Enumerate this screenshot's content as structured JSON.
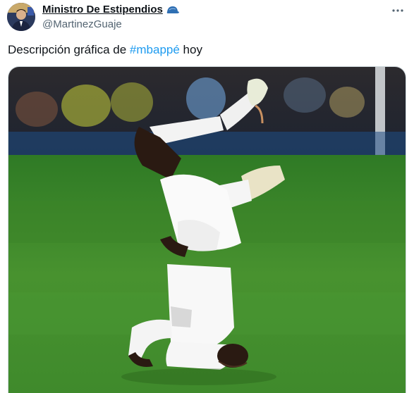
{
  "author": {
    "display_name": "Ministro De Estipendios",
    "handle": "@MartinezGuaje",
    "avatar_icon": "avatar-portrait",
    "badge_icon": "blue-cap-icon"
  },
  "tweet": {
    "text_before": "Descripción gráfica de ",
    "hashtag": "#mbappé",
    "text_after": " hoy"
  },
  "media": {
    "description_icon": "soccer-player-headstand-photo"
  },
  "colors": {
    "hashtag": "#1d9bf0",
    "handle": "#536471",
    "pitch": "#3f8a2c"
  }
}
